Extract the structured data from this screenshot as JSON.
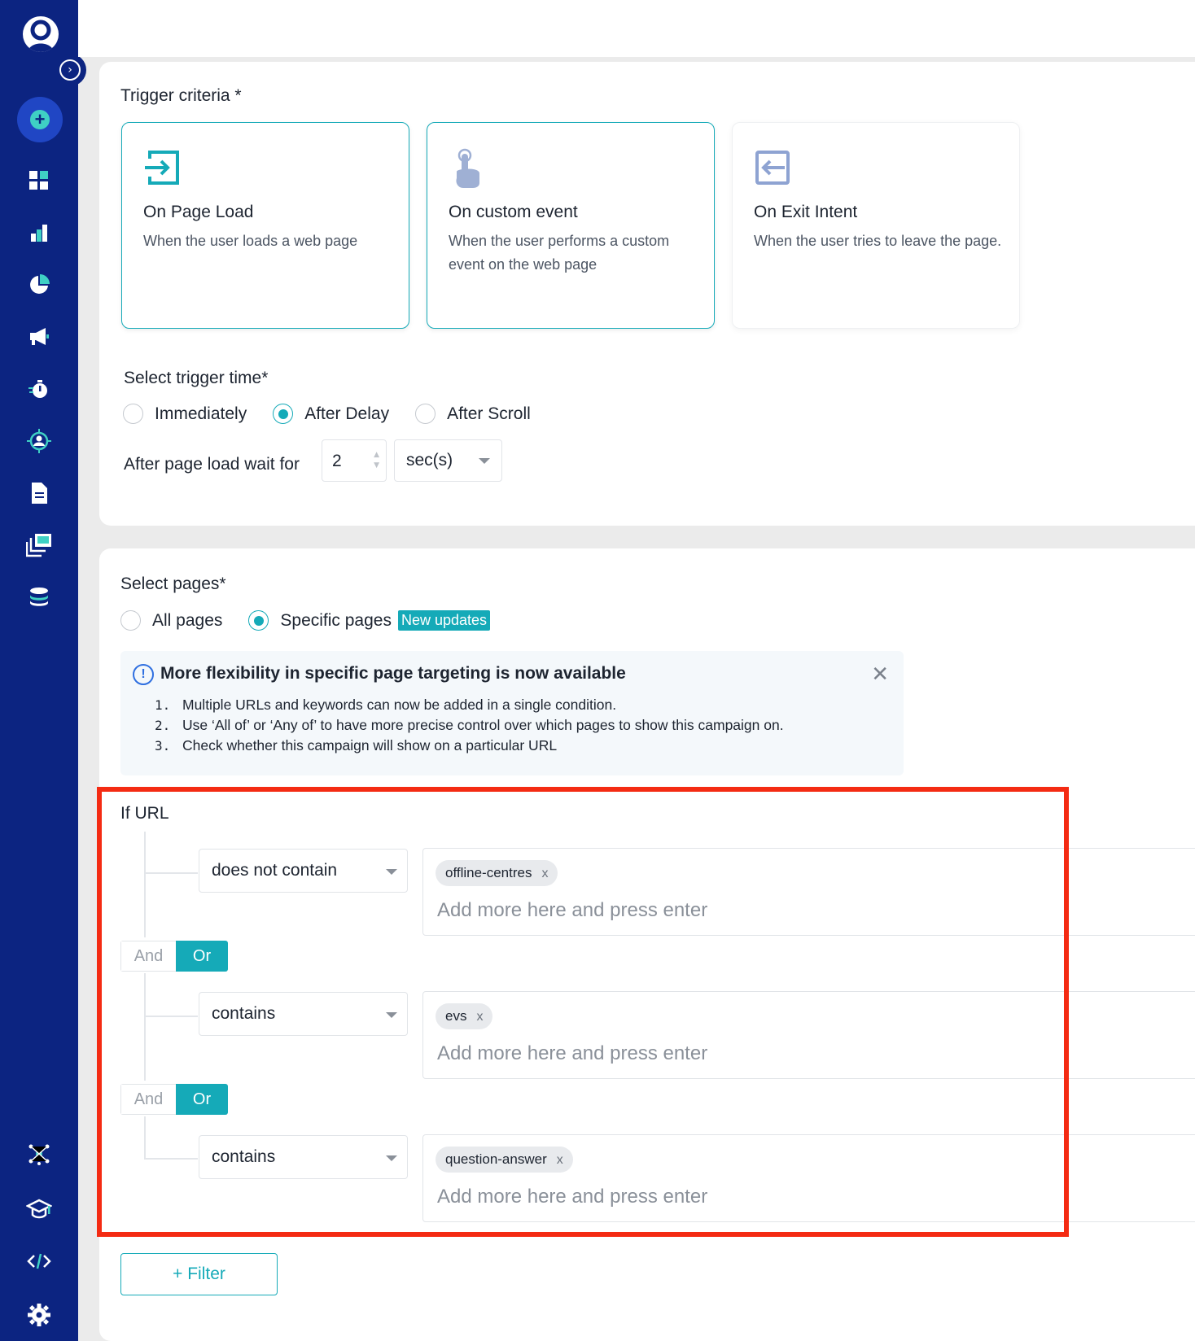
{
  "sidebar": {
    "items": [
      {
        "name": "dashboard-icon"
      },
      {
        "name": "bar-chart-icon"
      },
      {
        "name": "pie-chart-icon"
      },
      {
        "name": "megaphone-icon"
      },
      {
        "name": "stopwatch-icon"
      },
      {
        "name": "target-user-icon"
      },
      {
        "name": "document-icon"
      },
      {
        "name": "gallery-icon"
      },
      {
        "name": "database-icon"
      },
      {
        "name": "network-icon"
      },
      {
        "name": "graduation-cap-icon"
      },
      {
        "name": "code-icon"
      },
      {
        "name": "gear-icon"
      }
    ],
    "expand_glyph": "›",
    "add_glyph": "+"
  },
  "trigger": {
    "title": "Trigger criteria *",
    "cards": [
      {
        "title": "On Page Load",
        "desc": "When the user loads a web page",
        "icon": "enter-icon",
        "selected": true
      },
      {
        "title": "On custom event",
        "desc": "When the user performs a custom event on the web page",
        "icon": "tap-icon",
        "selected": true
      },
      {
        "title": "On Exit Intent",
        "desc": "When the user tries to leave the page.",
        "icon": "exit-icon",
        "selected": false
      }
    ]
  },
  "trigger_time": {
    "title": "Select trigger time*",
    "options": [
      "Immediately",
      "After Delay",
      "After Scroll"
    ],
    "selected": "After Delay",
    "wait_label": "After page load wait for",
    "wait_value": "2",
    "unit": "sec(s)"
  },
  "pages": {
    "title": "Select pages*",
    "options": [
      "All pages",
      "Specific pages"
    ],
    "selected": "Specific pages",
    "badge": "New updates"
  },
  "info": {
    "icon_glyph": "!",
    "close_glyph": "✕",
    "title": "More flexibility in specific page targeting is now available",
    "items": [
      {
        "n": "1.",
        "text": "Multiple URLs and keywords can now be added in a single condition."
      },
      {
        "n": "2.",
        "text": "Use ‘All of’ or ‘Any of’ to have more precise control over which pages to show this campaign on."
      },
      {
        "n": "3.",
        "text": "Check whether this campaign will show on a particular URL"
      }
    ]
  },
  "conditions": {
    "label": "If URL",
    "rows": [
      {
        "operator": "does not contain",
        "tag": "offline-centres",
        "placeholder": "Add more here and press enter"
      },
      {
        "operator": "contains",
        "tag": "evs",
        "placeholder": "Add more here and press enter"
      },
      {
        "operator": "contains",
        "tag": "question-answer",
        "placeholder": "Add more here and press enter"
      }
    ],
    "and_label": "And",
    "or_label": "Or",
    "remove_glyph": "x"
  },
  "filter_button": "+ Filter",
  "colors": {
    "sidebar": "#0c2481",
    "accent": "#15aab8",
    "highlight": "#f42b13"
  }
}
